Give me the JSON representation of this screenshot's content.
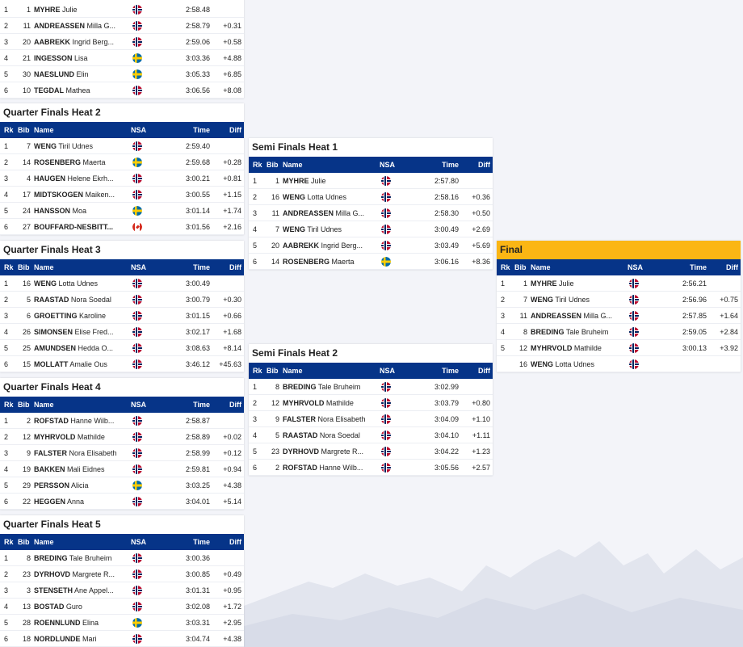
{
  "header": {
    "rk": "Rk",
    "bib": "Bib",
    "name": "Name",
    "nsa": "NSA",
    "time": "Time",
    "diff": "Diff"
  },
  "heats": [
    {
      "title": "",
      "rows": [
        {
          "rk": "1",
          "bib": "1",
          "last": "MYHRE",
          "first": "Julie",
          "nsa": "NOR",
          "time": "2:58.48",
          "diff": ""
        },
        {
          "rk": "2",
          "bib": "11",
          "last": "ANDREASSEN",
          "first": "Milla G...",
          "nsa": "NOR",
          "time": "2:58.79",
          "diff": "+0.31"
        },
        {
          "rk": "3",
          "bib": "20",
          "last": "AABREKK",
          "first": "Ingrid Berg...",
          "nsa": "NOR",
          "time": "2:59.06",
          "diff": "+0.58"
        },
        {
          "rk": "4",
          "bib": "21",
          "last": "INGESSON",
          "first": "Lisa",
          "nsa": "SWE",
          "time": "3:03.36",
          "diff": "+4.88"
        },
        {
          "rk": "5",
          "bib": "30",
          "last": "NAESLUND",
          "first": "Elin",
          "nsa": "SWE",
          "time": "3:05.33",
          "diff": "+6.85"
        },
        {
          "rk": "6",
          "bib": "10",
          "last": "TEGDAL",
          "first": "Mathea",
          "nsa": "NOR",
          "time": "3:06.56",
          "diff": "+8.08"
        }
      ]
    },
    {
      "title": "Quarter Finals Heat 2",
      "rows": [
        {
          "rk": "1",
          "bib": "7",
          "last": "WENG",
          "first": "Tiril Udnes",
          "nsa": "NOR",
          "time": "2:59.40",
          "diff": ""
        },
        {
          "rk": "2",
          "bib": "14",
          "last": "ROSENBERG",
          "first": "Maerta",
          "nsa": "SWE",
          "time": "2:59.68",
          "diff": "+0.28"
        },
        {
          "rk": "3",
          "bib": "4",
          "last": "HAUGEN",
          "first": "Helene Ekrh...",
          "nsa": "NOR",
          "time": "3:00.21",
          "diff": "+0.81"
        },
        {
          "rk": "4",
          "bib": "17",
          "last": "MIDTSKOGEN",
          "first": "Maiken...",
          "nsa": "NOR",
          "time": "3:00.55",
          "diff": "+1.15"
        },
        {
          "rk": "5",
          "bib": "24",
          "last": "HANSSON",
          "first": "Moa",
          "nsa": "SWE",
          "time": "3:01.14",
          "diff": "+1.74"
        },
        {
          "rk": "6",
          "bib": "27",
          "last": "BOUFFARD-NESBITT...",
          "first": "",
          "nsa": "CAN",
          "time": "3:01.56",
          "diff": "+2.16"
        }
      ]
    },
    {
      "title": "Quarter Finals Heat 3",
      "rows": [
        {
          "rk": "1",
          "bib": "16",
          "last": "WENG",
          "first": "Lotta Udnes",
          "nsa": "NOR",
          "time": "3:00.49",
          "diff": ""
        },
        {
          "rk": "2",
          "bib": "5",
          "last": "RAASTAD",
          "first": "Nora Soedal",
          "nsa": "NOR",
          "time": "3:00.79",
          "diff": "+0.30"
        },
        {
          "rk": "3",
          "bib": "6",
          "last": "GROETTING",
          "first": "Karoline",
          "nsa": "NOR",
          "time": "3:01.15",
          "diff": "+0.66"
        },
        {
          "rk": "4",
          "bib": "26",
          "last": "SIMONSEN",
          "first": "Elise Fred...",
          "nsa": "NOR",
          "time": "3:02.17",
          "diff": "+1.68"
        },
        {
          "rk": "5",
          "bib": "25",
          "last": "AMUNDSEN",
          "first": "Hedda O...",
          "nsa": "NOR",
          "time": "3:08.63",
          "diff": "+8.14"
        },
        {
          "rk": "6",
          "bib": "15",
          "last": "MOLLATT",
          "first": "Amalie Ous",
          "nsa": "NOR",
          "time": "3:46.12",
          "diff": "+45.63"
        }
      ]
    },
    {
      "title": "Quarter Finals Heat 4",
      "rows": [
        {
          "rk": "1",
          "bib": "2",
          "last": "ROFSTAD",
          "first": "Hanne Wilb...",
          "nsa": "NOR",
          "time": "2:58.87",
          "diff": ""
        },
        {
          "rk": "2",
          "bib": "12",
          "last": "MYHRVOLD",
          "first": "Mathilde",
          "nsa": "NOR",
          "time": "2:58.89",
          "diff": "+0.02"
        },
        {
          "rk": "3",
          "bib": "9",
          "last": "FALSTER",
          "first": "Nora Elisabeth",
          "nsa": "NOR",
          "time": "2:58.99",
          "diff": "+0.12"
        },
        {
          "rk": "4",
          "bib": "19",
          "last": "BAKKEN",
          "first": "Mali Eidnes",
          "nsa": "NOR",
          "time": "2:59.81",
          "diff": "+0.94"
        },
        {
          "rk": "5",
          "bib": "29",
          "last": "PERSSON",
          "first": "Alicia",
          "nsa": "SWE",
          "time": "3:03.25",
          "diff": "+4.38"
        },
        {
          "rk": "6",
          "bib": "22",
          "last": "HEGGEN",
          "first": "Anna",
          "nsa": "NOR",
          "time": "3:04.01",
          "diff": "+5.14"
        }
      ]
    },
    {
      "title": "Quarter Finals Heat 5",
      "rows": [
        {
          "rk": "1",
          "bib": "8",
          "last": "BREDING",
          "first": "Tale Bruheim",
          "nsa": "NOR",
          "time": "3:00.36",
          "diff": ""
        },
        {
          "rk": "2",
          "bib": "23",
          "last": "DYRHOVD",
          "first": "Margrete R...",
          "nsa": "NOR",
          "time": "3:00.85",
          "diff": "+0.49"
        },
        {
          "rk": "3",
          "bib": "3",
          "last": "STENSETH",
          "first": "Ane Appel...",
          "nsa": "NOR",
          "time": "3:01.31",
          "diff": "+0.95"
        },
        {
          "rk": "4",
          "bib": "13",
          "last": "BOSTAD",
          "first": "Guro",
          "nsa": "NOR",
          "time": "3:02.08",
          "diff": "+1.72"
        },
        {
          "rk": "5",
          "bib": "28",
          "last": "ROENNLUND",
          "first": "Elina",
          "nsa": "SWE",
          "time": "3:03.31",
          "diff": "+2.95"
        },
        {
          "rk": "6",
          "bib": "18",
          "last": "NORDLUNDE",
          "first": "Mari",
          "nsa": "NOR",
          "time": "3:04.74",
          "diff": "+4.38"
        }
      ]
    },
    {
      "title": "Semi Finals Heat 1",
      "rows": [
        {
          "rk": "1",
          "bib": "1",
          "last": "MYHRE",
          "first": "Julie",
          "nsa": "NOR",
          "time": "2:57.80",
          "diff": ""
        },
        {
          "rk": "2",
          "bib": "16",
          "last": "WENG",
          "first": "Lotta Udnes",
          "nsa": "NOR",
          "time": "2:58.16",
          "diff": "+0.36"
        },
        {
          "rk": "3",
          "bib": "11",
          "last": "ANDREASSEN",
          "first": "Milla G...",
          "nsa": "NOR",
          "time": "2:58.30",
          "diff": "+0.50"
        },
        {
          "rk": "4",
          "bib": "7",
          "last": "WENG",
          "first": "Tiril Udnes",
          "nsa": "NOR",
          "time": "3:00.49",
          "diff": "+2.69"
        },
        {
          "rk": "5",
          "bib": "20",
          "last": "AABREKK",
          "first": "Ingrid Berg...",
          "nsa": "NOR",
          "time": "3:03.49",
          "diff": "+5.69"
        },
        {
          "rk": "6",
          "bib": "14",
          "last": "ROSENBERG",
          "first": "Maerta",
          "nsa": "SWE",
          "time": "3:06.16",
          "diff": "+8.36"
        }
      ]
    },
    {
      "title": "Semi Finals Heat 2",
      "rows": [
        {
          "rk": "1",
          "bib": "8",
          "last": "BREDING",
          "first": "Tale Bruheim",
          "nsa": "NOR",
          "time": "3:02.99",
          "diff": ""
        },
        {
          "rk": "2",
          "bib": "12",
          "last": "MYHRVOLD",
          "first": "Mathilde",
          "nsa": "NOR",
          "time": "3:03.79",
          "diff": "+0.80"
        },
        {
          "rk": "3",
          "bib": "9",
          "last": "FALSTER",
          "first": "Nora Elisabeth",
          "nsa": "NOR",
          "time": "3:04.09",
          "diff": "+1.10"
        },
        {
          "rk": "4",
          "bib": "5",
          "last": "RAASTAD",
          "first": "Nora Soedal",
          "nsa": "NOR",
          "time": "3:04.10",
          "diff": "+1.11"
        },
        {
          "rk": "5",
          "bib": "23",
          "last": "DYRHOVD",
          "first": "Margrete R...",
          "nsa": "NOR",
          "time": "3:04.22",
          "diff": "+1.23"
        },
        {
          "rk": "6",
          "bib": "2",
          "last": "ROFSTAD",
          "first": "Hanne Wilb...",
          "nsa": "NOR",
          "time": "3:05.56",
          "diff": "+2.57"
        }
      ]
    },
    {
      "title": "Final",
      "rows": [
        {
          "rk": "1",
          "bib": "1",
          "last": "MYHRE",
          "first": "Julie",
          "nsa": "NOR",
          "time": "2:56.21",
          "diff": ""
        },
        {
          "rk": "2",
          "bib": "7",
          "last": "WENG",
          "first": "Tiril Udnes",
          "nsa": "NOR",
          "time": "2:56.96",
          "diff": "+0.75"
        },
        {
          "rk": "3",
          "bib": "11",
          "last": "ANDREASSEN",
          "first": "Milla G...",
          "nsa": "NOR",
          "time": "2:57.85",
          "diff": "+1.64"
        },
        {
          "rk": "4",
          "bib": "8",
          "last": "BREDING",
          "first": "Tale Bruheim",
          "nsa": "NOR",
          "time": "2:59.05",
          "diff": "+2.84"
        },
        {
          "rk": "5",
          "bib": "12",
          "last": "MYHRVOLD",
          "first": "Mathilde",
          "nsa": "NOR",
          "time": "3:00.13",
          "diff": "+3.92"
        },
        {
          "rk": "",
          "bib": "16",
          "last": "WENG",
          "first": "Lotta Udnes",
          "nsa": "NOR",
          "time": "",
          "diff": ""
        }
      ]
    }
  ],
  "colors": {
    "header_bg": "#063488",
    "final_title_bg": "#fbb614",
    "page_bg": "#f3f4f9"
  }
}
